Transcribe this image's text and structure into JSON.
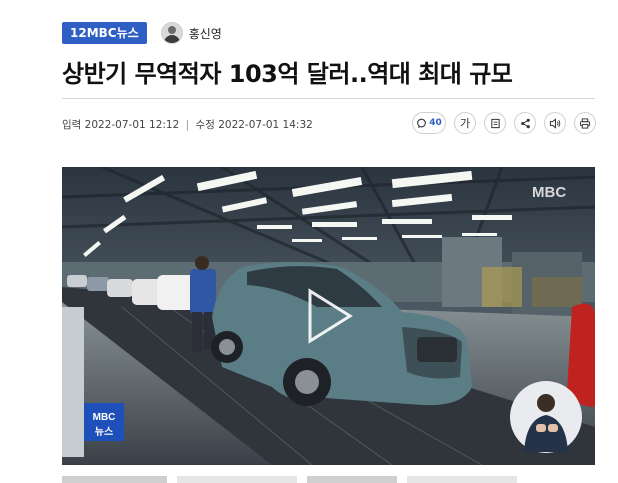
{
  "article": {
    "category_badge": "12MBC뉴스",
    "reporter": "홍신영",
    "title": "상반기 무역적자 103억 달러..역대 최대 규모",
    "meta": {
      "input_label": "입력",
      "input_time": "2022-07-01 12:12",
      "separator": "|",
      "edit_label": "수정",
      "edit_time": "2022-07-01 14:32"
    }
  },
  "toolbar": {
    "comment_count": "40",
    "font_size_label": "가",
    "icons": [
      "comment-icon",
      "font-size-icon",
      "copy-icon",
      "share-icon",
      "speaker-icon",
      "print-icon"
    ]
  },
  "video": {
    "broadcaster_logo": "MBC",
    "news_logo_line1": "MBC",
    "news_logo_line2": "뉴스",
    "colors": {
      "car_teal": "#5b7d86",
      "floor": "#3a4047",
      "ceiling_light": "#f5f7f2",
      "logo_blue": "#1f4fb8"
    }
  },
  "colors": {
    "badge": "#2f5fc4",
    "divider": "#d6d6d6"
  }
}
